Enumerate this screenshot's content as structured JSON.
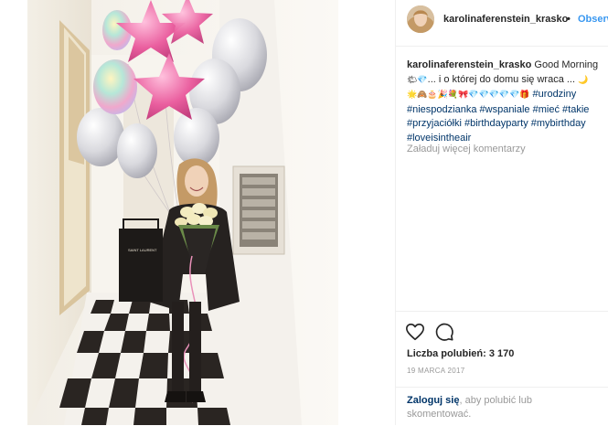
{
  "header": {
    "username": "karolinaferenstein_krasko",
    "separator": "•",
    "follow_label": "Obserwuj"
  },
  "caption": {
    "username": "karolinaferenstein_krasko",
    "text_1": "Good Morning",
    "text_2": "... i o której do domu się wraca ...",
    "hashtags": [
      "#urodziny",
      "#niespodzianka",
      "#wspaniale",
      "#mieć",
      "#takie",
      "#przyjaciółki",
      "#birthdayparty",
      "#mybirthday",
      "#loveisintheair"
    ]
  },
  "comments": {
    "load_more_label": "Załaduj więcej komentarzy"
  },
  "actions": {
    "like_icon": "heart-icon",
    "comment_icon": "comment-icon"
  },
  "likes": {
    "label": "Liczba polubień:",
    "count": "3 170"
  },
  "date": "19 MARCA 2017",
  "login_prompt": {
    "link": "Zaloguj się",
    "rest": ", aby polubić lub skomentować."
  },
  "colors": {
    "link": "#003569",
    "follow": "#3897f0",
    "muted": "#999999",
    "balloon_pink": "#e8569a"
  }
}
